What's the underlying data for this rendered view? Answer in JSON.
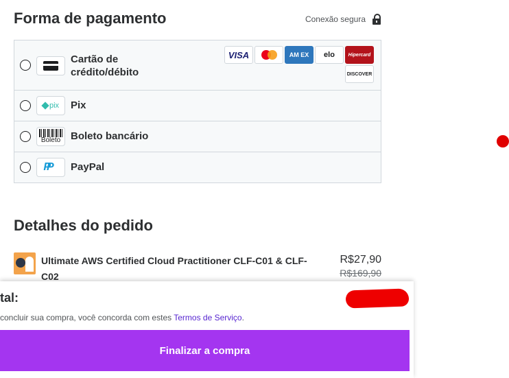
{
  "payment": {
    "title": "Forma de pagamento",
    "secure_label": "Conexão segura",
    "options": [
      {
        "label": "Cartão de crédito/débito",
        "icon": "credit-card-icon"
      },
      {
        "label": "Pix",
        "icon": "pix-logo",
        "logo_text": "pix"
      },
      {
        "label": "Boleto bancário",
        "icon": "boleto-logo",
        "logo_text": "Boleto"
      },
      {
        "label": "PayPal",
        "icon": "paypal-logo",
        "logo_text": "P"
      }
    ],
    "card_brands": [
      "VISA",
      "Mastercard",
      "AMEX",
      "elo",
      "Hipercard",
      "DISCOVER"
    ],
    "brand_text": {
      "visa": "VISA",
      "amex": "AM EX",
      "elo": "elo",
      "hipercard": "Hipercard",
      "discover": "DISCOVER"
    }
  },
  "order": {
    "title": "Detalhes do pedido",
    "items": [
      {
        "title": "Ultimate AWS Certified Cloud Practitioner CLF-C01 & CLF-C02",
        "price": "R$27,90",
        "original_price": "R$169,90"
      }
    ]
  },
  "footer": {
    "total_label": "tal:",
    "terms_prefix": "concluir sua compra, você concorda com estes ",
    "terms_link": "Termos de Serviço",
    "terms_suffix": ".",
    "checkout_button": "Finalizar a compra"
  },
  "colors": {
    "accent": "#a435f0",
    "link": "#5624d0",
    "redaction": "#ee0000"
  }
}
